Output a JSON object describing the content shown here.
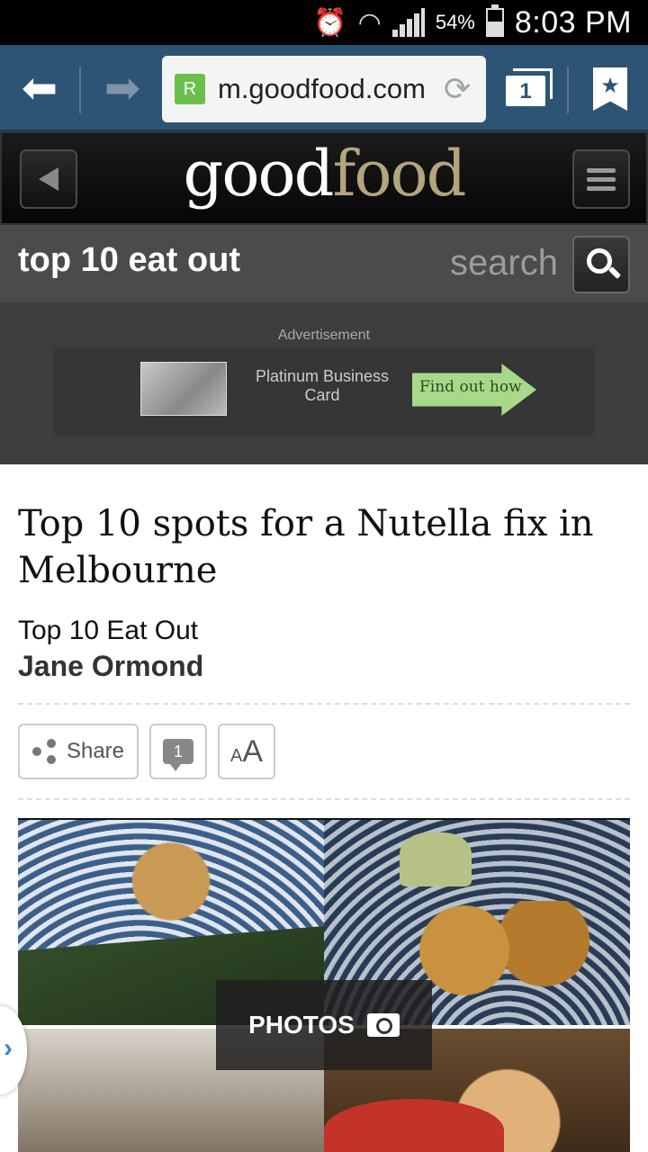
{
  "status_bar": {
    "battery_pct": "54%",
    "battery_level": 0.54,
    "time": "8:03 PM",
    "icons": [
      "alarm-icon",
      "wifi-icon",
      "signal-icon",
      "battery-icon"
    ]
  },
  "browser": {
    "url": "m.goodfood.com",
    "tab_count": "1",
    "icons": [
      "back-arrow-icon",
      "forward-arrow-icon",
      "reload-icon",
      "tabs-icon",
      "bookmark-icon"
    ]
  },
  "site": {
    "logo_part1": "good",
    "logo_part2": "food",
    "logo_color_accent": "#b3a57d"
  },
  "section": {
    "title": "top 10 eat out",
    "search_label": "search"
  },
  "ad": {
    "label": "Advertisement",
    "product": "Platinum Business Card",
    "cta": "Find out how"
  },
  "article": {
    "headline": "Top 10 spots for a Nutella fix in Melbourne",
    "category": "Top 10 Eat Out",
    "author": "Jane Ormond",
    "share_label": "Share",
    "comment_count": "1",
    "font_small": "A",
    "font_large": "A"
  },
  "gallery": {
    "label": "PHOTOS"
  }
}
